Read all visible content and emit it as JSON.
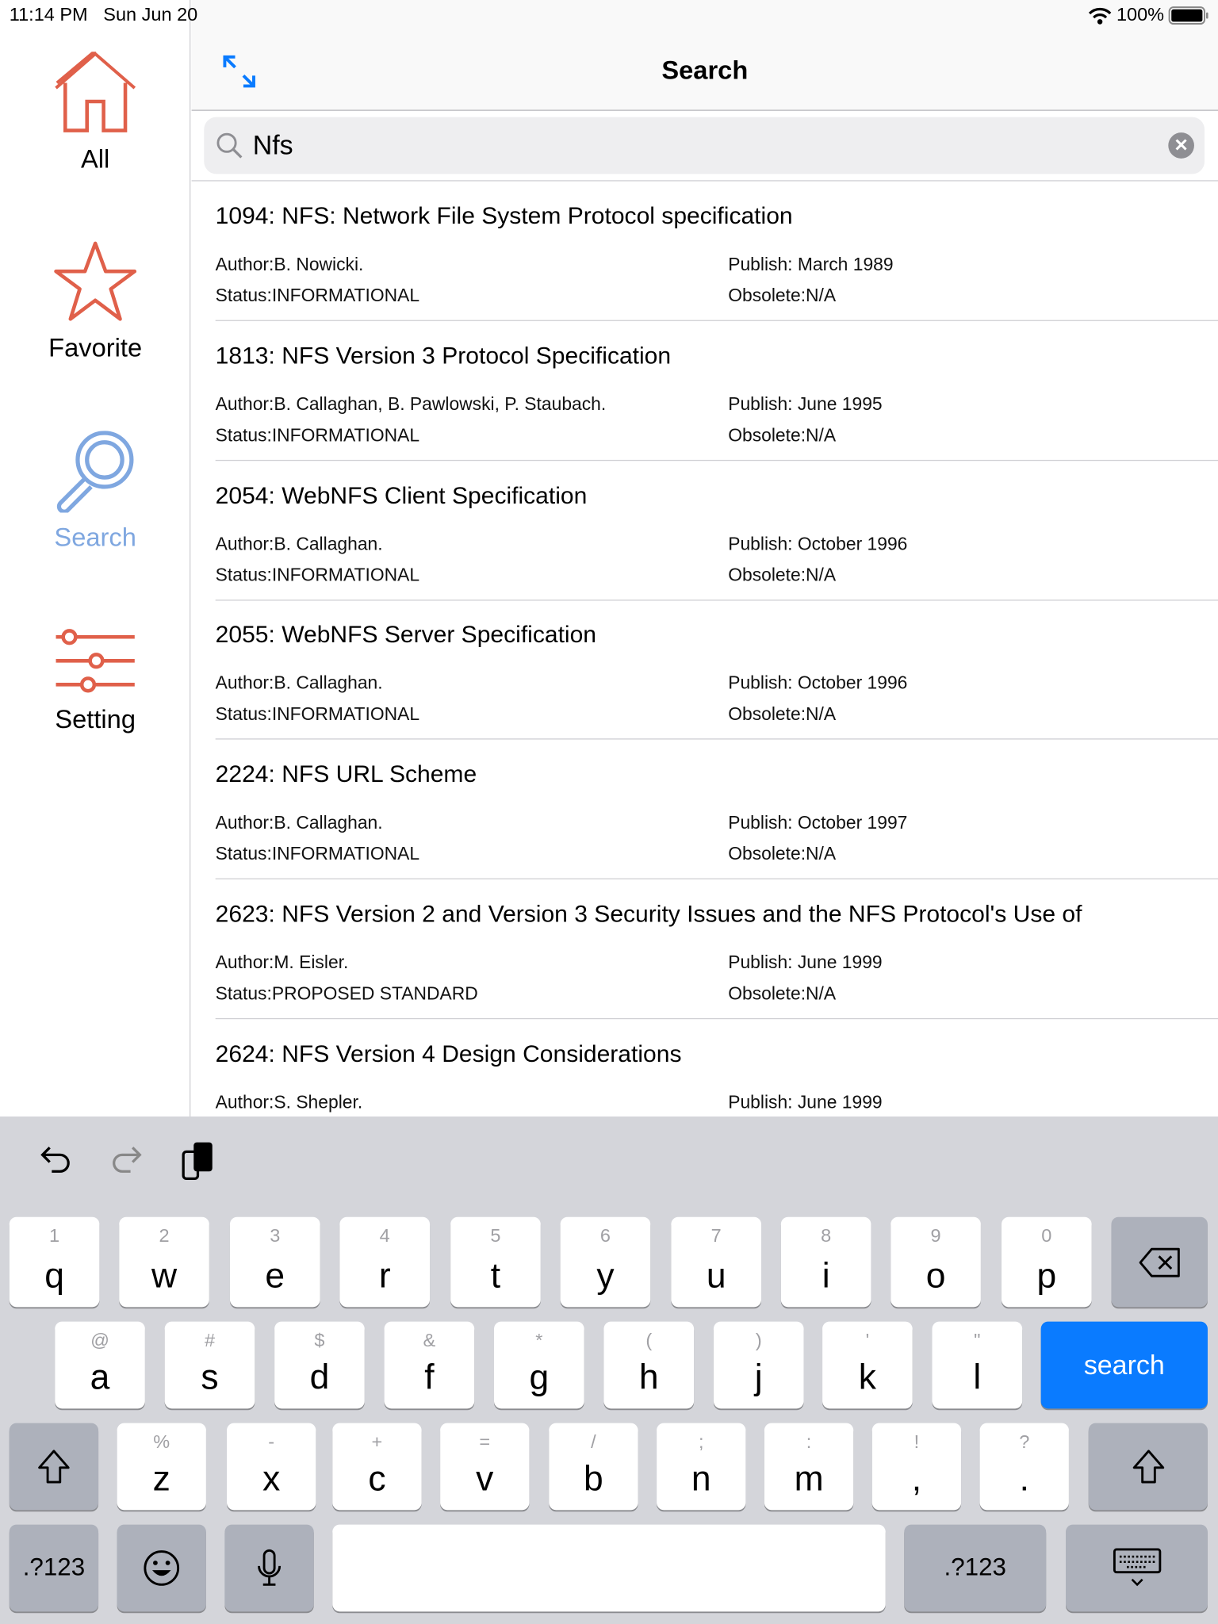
{
  "status_bar": {
    "time": "11:14 PM",
    "date": "Sun Jun 20",
    "battery": "100%"
  },
  "colors": {
    "accent": "#E0604A",
    "selected": "#7FA7E0",
    "keyboard_action": "#0A7BFF"
  },
  "sidebar": {
    "items": [
      {
        "label": "All",
        "icon": "home-icon"
      },
      {
        "label": "Favorite",
        "icon": "star-icon"
      },
      {
        "label": "Search",
        "icon": "search-icon",
        "selected": true
      },
      {
        "label": "Setting",
        "icon": "sliders-icon"
      }
    ]
  },
  "header": {
    "title": "Search",
    "expand_icon": "expand-arrows-icon"
  },
  "search": {
    "value": "Nfs",
    "clear_icon": "clear-icon"
  },
  "results": [
    {
      "title": "1094: NFS: Network File System Protocol specification",
      "author": "Author:B. Nowicki.",
      "publish": "Publish: March 1989",
      "status": "Status:INFORMATIONAL",
      "obsolete": "Obsolete:N/A"
    },
    {
      "title": "1813: NFS Version 3 Protocol Specification",
      "author": "Author:B. Callaghan, B. Pawlowski, P. Staubach.",
      "publish": "Publish: June 1995",
      "status": "Status:INFORMATIONAL",
      "obsolete": "Obsolete:N/A"
    },
    {
      "title": "2054: WebNFS Client Specification",
      "author": "Author:B. Callaghan.",
      "publish": "Publish: October 1996",
      "status": "Status:INFORMATIONAL",
      "obsolete": "Obsolete:N/A"
    },
    {
      "title": "2055: WebNFS Server Specification",
      "author": "Author:B. Callaghan.",
      "publish": "Publish: October 1996",
      "status": "Status:INFORMATIONAL",
      "obsolete": "Obsolete:N/A"
    },
    {
      "title": "2224: NFS URL Scheme",
      "author": "Author:B. Callaghan.",
      "publish": "Publish: October 1997",
      "status": "Status:INFORMATIONAL",
      "obsolete": "Obsolete:N/A"
    },
    {
      "title": "2623: NFS Version 2 and Version 3 Security Issues and the NFS Protocol's Use of",
      "author": "Author:M. Eisler.",
      "publish": "Publish: June 1999",
      "status": "Status:PROPOSED STANDARD",
      "obsolete": "Obsolete:N/A"
    },
    {
      "title": "2624: NFS Version 4 Design Considerations",
      "author": "Author:S. Shepler.",
      "publish": "Publish: June 1999",
      "status": "",
      "obsolete": ""
    }
  ],
  "keyboard": {
    "row1": [
      [
        "1",
        "q"
      ],
      [
        "2",
        "w"
      ],
      [
        "3",
        "e"
      ],
      [
        "4",
        "r"
      ],
      [
        "5",
        "t"
      ],
      [
        "6",
        "y"
      ],
      [
        "7",
        "u"
      ],
      [
        "8",
        "i"
      ],
      [
        "9",
        "o"
      ],
      [
        "0",
        "p"
      ]
    ],
    "row2": [
      [
        "@",
        "a"
      ],
      [
        "#",
        "s"
      ],
      [
        "$",
        "d"
      ],
      [
        "&",
        "f"
      ],
      [
        "*",
        "g"
      ],
      [
        "(",
        "h"
      ],
      [
        ")",
        "j"
      ],
      [
        "'",
        "k"
      ],
      [
        "\"",
        "l"
      ]
    ],
    "row3": [
      [
        "%",
        "z"
      ],
      [
        "-",
        "x"
      ],
      [
        "+",
        "c"
      ],
      [
        "=",
        "v"
      ],
      [
        "/",
        "b"
      ],
      [
        ";",
        "n"
      ],
      [
        ":",
        "m"
      ],
      [
        "!",
        ","
      ],
      [
        "?",
        "."
      ]
    ],
    "search_label": "search",
    "numbers_label": ".?123"
  }
}
